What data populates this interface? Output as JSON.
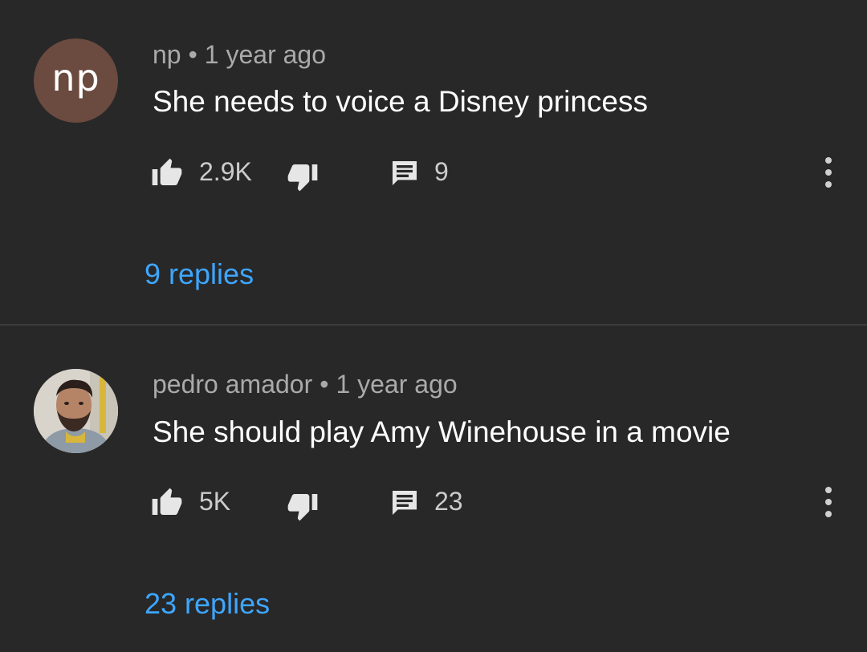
{
  "comments": [
    {
      "author": "np",
      "separator": "•",
      "time": "1 year ago",
      "text": "She needs to voice a Disney princess",
      "avatar": {
        "initials": "np",
        "bg_color": "#6b4a3f"
      },
      "likes": "2.9K",
      "reply_count": "9",
      "replies_link": "9 replies",
      "icons": [
        "thumbs-up-icon",
        "thumbs-down-icon",
        "reply-icon",
        "more-vert-icon"
      ]
    },
    {
      "author": "pedro amador",
      "separator": "•",
      "time": "1 year ago",
      "text": "She should play Amy Winehouse in a movie",
      "avatar": {
        "type": "photo",
        "bg_color": "#d8d4cc"
      },
      "likes": "5K",
      "reply_count": "23",
      "replies_link": "23 replies",
      "icons": [
        "thumbs-up-icon",
        "thumbs-down-icon",
        "reply-icon",
        "more-vert-icon"
      ]
    }
  ],
  "colors": {
    "background": "#282828",
    "divider": "#3c3c3c",
    "meta_text": "#aaaaaa",
    "body_text": "#ffffff",
    "link": "#3ea6ff"
  }
}
